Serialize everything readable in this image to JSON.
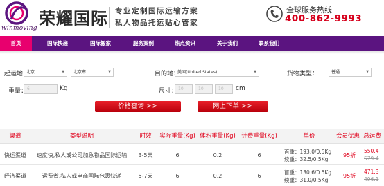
{
  "header": {
    "brand": "荣耀国际",
    "logo_sub": "winmoving",
    "slogan1": "专业定制国际运输方案",
    "slogan2": "私人物品托运贴心管家",
    "hotline_label": "全球服务热线",
    "hotline_number": "400-862-9993",
    "brand_color": "#5b1480",
    "accent_color": "#e8006e"
  },
  "nav": {
    "items": [
      {
        "label": "首页"
      },
      {
        "label": "国际快递"
      },
      {
        "label": "国际搬家"
      },
      {
        "label": "服务案例"
      },
      {
        "label": "热点资讯"
      },
      {
        "label": "关于我们"
      },
      {
        "label": "联系我们"
      }
    ]
  },
  "form": {
    "origin_label": "起运地：",
    "origin_country": "北京",
    "origin_city": "北京市",
    "dest_label": "目的地：",
    "dest_country": "美国(United States)",
    "cargo_label": "货物类型：",
    "cargo_type": "普通",
    "weight_label": "重量：",
    "weight_value": "6",
    "weight_unit": "Kg",
    "size_label": "尺寸：",
    "size_l": "10",
    "size_w": "10",
    "size_h": "10",
    "size_unit": "cm",
    "query_button": "价格查询  >>",
    "order_button": "网上下单  >>"
  },
  "table": {
    "headers": [
      "渠道",
      "类型说明",
      "时效",
      "实际重量(Kg)",
      "体积重量(Kg)",
      "计费重量(Kg)",
      "单价",
      "会员优惠",
      "总运费"
    ],
    "rows": [
      {
        "channel": "快运渠道",
        "desc": "速度快,私人或公司加急物品国际运输",
        "time": "3-5天",
        "actual": "6",
        "volume": "0.2",
        "billing": "6",
        "price_first": "首重：193.0/0.5Kg",
        "price_next": "续重：32.5/0.5Kg",
        "discount": "95折",
        "total": "550.4",
        "original": "579.4"
      },
      {
        "channel": "经济渠道",
        "desc": "运费省,私人或电商国际包裹快递",
        "time": "5-7天",
        "actual": "6",
        "volume": "0.2",
        "billing": "6",
        "price_first": "首重：130.6/0.5Kg",
        "price_next": "续重：31.0/0.5Kg",
        "discount": "95折",
        "total": "471.3",
        "original": "496.1"
      }
    ]
  }
}
